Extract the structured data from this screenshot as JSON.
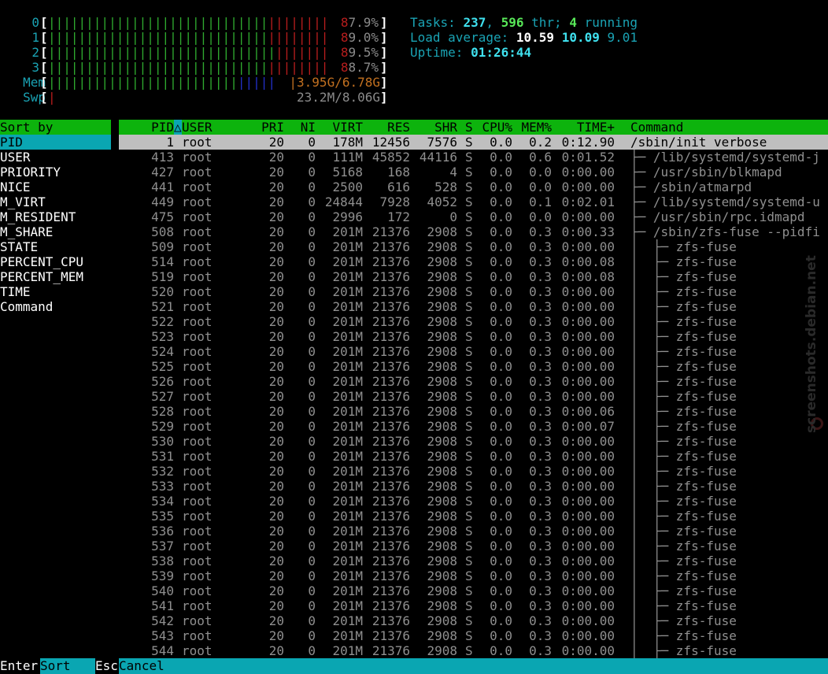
{
  "meters": {
    "cpus": [
      {
        "label": "0",
        "value": "87.9%",
        "percent": 87.9
      },
      {
        "label": "1",
        "value": "89.0%",
        "percent": 89.0
      },
      {
        "label": "2",
        "value": "89.5%",
        "percent": 89.5
      },
      {
        "label": "3",
        "value": "88.7%",
        "percent": 88.7
      }
    ],
    "mem": {
      "label": "Mem",
      "value": "3.95G/6.78G"
    },
    "swp": {
      "label": "Swp",
      "value": "23.2M/8.06G"
    }
  },
  "header": {
    "tasks_label": "Tasks:",
    "tasks_count": "237",
    "threads_count": "596",
    "threads_label": "thr;",
    "running_count": "4",
    "running_label": "running",
    "load_label": "Load average:",
    "load_1": "10.59",
    "load_5": "10.09",
    "load_15": "9.01",
    "uptime_label": "Uptime:",
    "uptime_value": "01:26:44"
  },
  "sort_panel": {
    "title": "Sort by",
    "items": [
      "PID",
      "USER",
      "PRIORITY",
      "NICE",
      "M_VIRT",
      "M_RESIDENT",
      "M_SHARE",
      "STATE",
      "PERCENT_CPU",
      "PERCENT_MEM",
      "TIME",
      "Command"
    ],
    "selected": "PID"
  },
  "columns": {
    "pid": "PID",
    "sort_arrow": "△",
    "user": "USER",
    "pri": "PRI",
    "ni": "NI",
    "virt": "VIRT",
    "res": "RES",
    "shr": "SHR",
    "s": "S",
    "cpu": "CPU%",
    "mem": "MEM%",
    "time": "TIME+",
    "command": "Command"
  },
  "processes": [
    {
      "pid": "1",
      "user": "root",
      "pri": "20",
      "ni": "0",
      "virt": "178M",
      "res": "12456",
      "shr": "7576",
      "s": "S",
      "cpu": "0.0",
      "mem": "0.2",
      "time": "0:12.90",
      "tree": "",
      "command": "/sbin/init verbose"
    },
    {
      "pid": "413",
      "user": "root",
      "pri": "20",
      "ni": "0",
      "virt": "111M",
      "res": "45852",
      "shr": "44116",
      "s": "S",
      "cpu": "0.0",
      "mem": "0.6",
      "time": "0:01.52",
      "tree": "├─ ",
      "command": "/lib/systemd/systemd-j"
    },
    {
      "pid": "427",
      "user": "root",
      "pri": "20",
      "ni": "0",
      "virt": "5168",
      "res": "168",
      "shr": "4",
      "s": "S",
      "cpu": "0.0",
      "mem": "0.0",
      "time": "0:00.00",
      "tree": "├─ ",
      "command": "/usr/sbin/blkmapd"
    },
    {
      "pid": "441",
      "user": "root",
      "pri": "20",
      "ni": "0",
      "virt": "2500",
      "res": "616",
      "shr": "528",
      "s": "S",
      "cpu": "0.0",
      "mem": "0.0",
      "time": "0:00.00",
      "tree": "├─ ",
      "command": "/sbin/atmarpd"
    },
    {
      "pid": "449",
      "user": "root",
      "pri": "20",
      "ni": "0",
      "virt": "24844",
      "res": "7928",
      "shr": "4052",
      "s": "S",
      "cpu": "0.0",
      "mem": "0.1",
      "time": "0:02.01",
      "tree": "├─ ",
      "command": "/lib/systemd/systemd-u"
    },
    {
      "pid": "475",
      "user": "root",
      "pri": "20",
      "ni": "0",
      "virt": "2996",
      "res": "172",
      "shr": "0",
      "s": "S",
      "cpu": "0.0",
      "mem": "0.0",
      "time": "0:00.00",
      "tree": "├─ ",
      "command": "/usr/sbin/rpc.idmapd"
    },
    {
      "pid": "508",
      "user": "root",
      "pri": "20",
      "ni": "0",
      "virt": "201M",
      "res": "21376",
      "shr": "2908",
      "s": "S",
      "cpu": "0.0",
      "mem": "0.3",
      "time": "0:00.33",
      "tree": "├─ ",
      "command": "/sbin/zfs-fuse --pidfi"
    },
    {
      "pid": "509",
      "user": "root",
      "pri": "20",
      "ni": "0",
      "virt": "201M",
      "res": "21376",
      "shr": "2908",
      "s": "S",
      "cpu": "0.0",
      "mem": "0.3",
      "time": "0:00.00",
      "tree": "│  ├─ ",
      "command": "zfs-fuse"
    },
    {
      "pid": "514",
      "user": "root",
      "pri": "20",
      "ni": "0",
      "virt": "201M",
      "res": "21376",
      "shr": "2908",
      "s": "S",
      "cpu": "0.0",
      "mem": "0.3",
      "time": "0:00.08",
      "tree": "│  ├─ ",
      "command": "zfs-fuse"
    },
    {
      "pid": "519",
      "user": "root",
      "pri": "20",
      "ni": "0",
      "virt": "201M",
      "res": "21376",
      "shr": "2908",
      "s": "S",
      "cpu": "0.0",
      "mem": "0.3",
      "time": "0:00.08",
      "tree": "│  ├─ ",
      "command": "zfs-fuse"
    },
    {
      "pid": "520",
      "user": "root",
      "pri": "20",
      "ni": "0",
      "virt": "201M",
      "res": "21376",
      "shr": "2908",
      "s": "S",
      "cpu": "0.0",
      "mem": "0.3",
      "time": "0:00.00",
      "tree": "│  ├─ ",
      "command": "zfs-fuse"
    },
    {
      "pid": "521",
      "user": "root",
      "pri": "20",
      "ni": "0",
      "virt": "201M",
      "res": "21376",
      "shr": "2908",
      "s": "S",
      "cpu": "0.0",
      "mem": "0.3",
      "time": "0:00.00",
      "tree": "│  ├─ ",
      "command": "zfs-fuse"
    },
    {
      "pid": "522",
      "user": "root",
      "pri": "20",
      "ni": "0",
      "virt": "201M",
      "res": "21376",
      "shr": "2908",
      "s": "S",
      "cpu": "0.0",
      "mem": "0.3",
      "time": "0:00.00",
      "tree": "│  ├─ ",
      "command": "zfs-fuse"
    },
    {
      "pid": "523",
      "user": "root",
      "pri": "20",
      "ni": "0",
      "virt": "201M",
      "res": "21376",
      "shr": "2908",
      "s": "S",
      "cpu": "0.0",
      "mem": "0.3",
      "time": "0:00.00",
      "tree": "│  ├─ ",
      "command": "zfs-fuse"
    },
    {
      "pid": "524",
      "user": "root",
      "pri": "20",
      "ni": "0",
      "virt": "201M",
      "res": "21376",
      "shr": "2908",
      "s": "S",
      "cpu": "0.0",
      "mem": "0.3",
      "time": "0:00.00",
      "tree": "│  ├─ ",
      "command": "zfs-fuse"
    },
    {
      "pid": "525",
      "user": "root",
      "pri": "20",
      "ni": "0",
      "virt": "201M",
      "res": "21376",
      "shr": "2908",
      "s": "S",
      "cpu": "0.0",
      "mem": "0.3",
      "time": "0:00.00",
      "tree": "│  ├─ ",
      "command": "zfs-fuse"
    },
    {
      "pid": "526",
      "user": "root",
      "pri": "20",
      "ni": "0",
      "virt": "201M",
      "res": "21376",
      "shr": "2908",
      "s": "S",
      "cpu": "0.0",
      "mem": "0.3",
      "time": "0:00.00",
      "tree": "│  ├─ ",
      "command": "zfs-fuse"
    },
    {
      "pid": "527",
      "user": "root",
      "pri": "20",
      "ni": "0",
      "virt": "201M",
      "res": "21376",
      "shr": "2908",
      "s": "S",
      "cpu": "0.0",
      "mem": "0.3",
      "time": "0:00.00",
      "tree": "│  ├─ ",
      "command": "zfs-fuse"
    },
    {
      "pid": "528",
      "user": "root",
      "pri": "20",
      "ni": "0",
      "virt": "201M",
      "res": "21376",
      "shr": "2908",
      "s": "S",
      "cpu": "0.0",
      "mem": "0.3",
      "time": "0:00.06",
      "tree": "│  ├─ ",
      "command": "zfs-fuse"
    },
    {
      "pid": "529",
      "user": "root",
      "pri": "20",
      "ni": "0",
      "virt": "201M",
      "res": "21376",
      "shr": "2908",
      "s": "S",
      "cpu": "0.0",
      "mem": "0.3",
      "time": "0:00.07",
      "tree": "│  ├─ ",
      "command": "zfs-fuse"
    },
    {
      "pid": "530",
      "user": "root",
      "pri": "20",
      "ni": "0",
      "virt": "201M",
      "res": "21376",
      "shr": "2908",
      "s": "S",
      "cpu": "0.0",
      "mem": "0.3",
      "time": "0:00.00",
      "tree": "│  ├─ ",
      "command": "zfs-fuse"
    },
    {
      "pid": "531",
      "user": "root",
      "pri": "20",
      "ni": "0",
      "virt": "201M",
      "res": "21376",
      "shr": "2908",
      "s": "S",
      "cpu": "0.0",
      "mem": "0.3",
      "time": "0:00.00",
      "tree": "│  ├─ ",
      "command": "zfs-fuse"
    },
    {
      "pid": "532",
      "user": "root",
      "pri": "20",
      "ni": "0",
      "virt": "201M",
      "res": "21376",
      "shr": "2908",
      "s": "S",
      "cpu": "0.0",
      "mem": "0.3",
      "time": "0:00.00",
      "tree": "│  ├─ ",
      "command": "zfs-fuse"
    },
    {
      "pid": "533",
      "user": "root",
      "pri": "20",
      "ni": "0",
      "virt": "201M",
      "res": "21376",
      "shr": "2908",
      "s": "S",
      "cpu": "0.0",
      "mem": "0.3",
      "time": "0:00.00",
      "tree": "│  ├─ ",
      "command": "zfs-fuse"
    },
    {
      "pid": "534",
      "user": "root",
      "pri": "20",
      "ni": "0",
      "virt": "201M",
      "res": "21376",
      "shr": "2908",
      "s": "S",
      "cpu": "0.0",
      "mem": "0.3",
      "time": "0:00.00",
      "tree": "│  ├─ ",
      "command": "zfs-fuse"
    },
    {
      "pid": "535",
      "user": "root",
      "pri": "20",
      "ni": "0",
      "virt": "201M",
      "res": "21376",
      "shr": "2908",
      "s": "S",
      "cpu": "0.0",
      "mem": "0.3",
      "time": "0:00.00",
      "tree": "│  ├─ ",
      "command": "zfs-fuse"
    },
    {
      "pid": "536",
      "user": "root",
      "pri": "20",
      "ni": "0",
      "virt": "201M",
      "res": "21376",
      "shr": "2908",
      "s": "S",
      "cpu": "0.0",
      "mem": "0.3",
      "time": "0:00.00",
      "tree": "│  ├─ ",
      "command": "zfs-fuse"
    },
    {
      "pid": "537",
      "user": "root",
      "pri": "20",
      "ni": "0",
      "virt": "201M",
      "res": "21376",
      "shr": "2908",
      "s": "S",
      "cpu": "0.0",
      "mem": "0.3",
      "time": "0:00.00",
      "tree": "│  ├─ ",
      "command": "zfs-fuse"
    },
    {
      "pid": "538",
      "user": "root",
      "pri": "20",
      "ni": "0",
      "virt": "201M",
      "res": "21376",
      "shr": "2908",
      "s": "S",
      "cpu": "0.0",
      "mem": "0.3",
      "time": "0:00.00",
      "tree": "│  ├─ ",
      "command": "zfs-fuse"
    },
    {
      "pid": "539",
      "user": "root",
      "pri": "20",
      "ni": "0",
      "virt": "201M",
      "res": "21376",
      "shr": "2908",
      "s": "S",
      "cpu": "0.0",
      "mem": "0.3",
      "time": "0:00.00",
      "tree": "│  ├─ ",
      "command": "zfs-fuse"
    },
    {
      "pid": "540",
      "user": "root",
      "pri": "20",
      "ni": "0",
      "virt": "201M",
      "res": "21376",
      "shr": "2908",
      "s": "S",
      "cpu": "0.0",
      "mem": "0.3",
      "time": "0:00.00",
      "tree": "│  ├─ ",
      "command": "zfs-fuse"
    },
    {
      "pid": "541",
      "user": "root",
      "pri": "20",
      "ni": "0",
      "virt": "201M",
      "res": "21376",
      "shr": "2908",
      "s": "S",
      "cpu": "0.0",
      "mem": "0.3",
      "time": "0:00.00",
      "tree": "│  ├─ ",
      "command": "zfs-fuse"
    },
    {
      "pid": "542",
      "user": "root",
      "pri": "20",
      "ni": "0",
      "virt": "201M",
      "res": "21376",
      "shr": "2908",
      "s": "S",
      "cpu": "0.0",
      "mem": "0.3",
      "time": "0:00.00",
      "tree": "│  ├─ ",
      "command": "zfs-fuse"
    },
    {
      "pid": "543",
      "user": "root",
      "pri": "20",
      "ni": "0",
      "virt": "201M",
      "res": "21376",
      "shr": "2908",
      "s": "S",
      "cpu": "0.0",
      "mem": "0.3",
      "time": "0:00.00",
      "tree": "│  ├─ ",
      "command": "zfs-fuse"
    },
    {
      "pid": "544",
      "user": "root",
      "pri": "20",
      "ni": "0",
      "virt": "201M",
      "res": "21376",
      "shr": "2908",
      "s": "S",
      "cpu": "0.0",
      "mem": "0.3",
      "time": "0:00.00",
      "tree": "│  ├─ ",
      "command": "zfs-fuse"
    }
  ],
  "footer": {
    "enter_key": "Enter",
    "enter_label": "Sort",
    "esc_key": "Esc",
    "esc_label": "Cancel"
  },
  "watermark": "screenshots.debian.net",
  "colors": {
    "header_bar": "#0db30d",
    "selection_cyan": "#0aa6b2",
    "selected_row": "#bfbfbf",
    "meter_green": "#2faa2f",
    "meter_red": "#b81d1d",
    "meter_blue": "#2230c8",
    "meter_orange": "#c27020"
  }
}
